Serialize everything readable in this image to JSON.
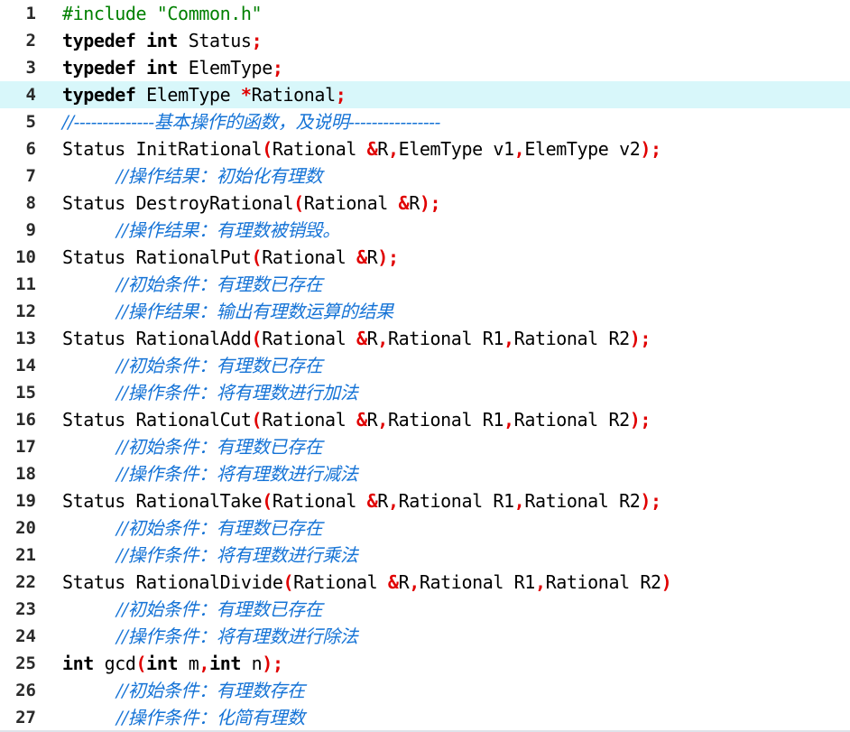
{
  "editor": {
    "current_line": 4,
    "lines": [
      {
        "num": "1",
        "indent": false,
        "tokens": [
          {
            "t": "pre",
            "v": "#include \"Common.h\""
          }
        ]
      },
      {
        "num": "2",
        "indent": false,
        "tokens": [
          {
            "t": "kw",
            "v": "typedef int"
          },
          {
            "t": "id",
            "v": " Status"
          },
          {
            "t": "op",
            "v": ";"
          }
        ]
      },
      {
        "num": "3",
        "indent": false,
        "tokens": [
          {
            "t": "kw",
            "v": "typedef int"
          },
          {
            "t": "id",
            "v": " ElemType"
          },
          {
            "t": "op",
            "v": ";"
          }
        ]
      },
      {
        "num": "4",
        "indent": false,
        "tokens": [
          {
            "t": "kw",
            "v": "typedef"
          },
          {
            "t": "id",
            "v": " ElemType "
          },
          {
            "t": "op",
            "v": "*"
          },
          {
            "t": "id",
            "v": "Rational"
          },
          {
            "t": "op",
            "v": ";"
          }
        ]
      },
      {
        "num": "5",
        "indent": false,
        "tokens": [
          {
            "t": "cm",
            "v": "//--------------基本操作的函数，及说明----------------"
          }
        ]
      },
      {
        "num": "6",
        "indent": false,
        "tokens": [
          {
            "t": "id",
            "v": "Status InitRational"
          },
          {
            "t": "op",
            "v": "("
          },
          {
            "t": "id",
            "v": "Rational "
          },
          {
            "t": "op",
            "v": "&"
          },
          {
            "t": "id",
            "v": "R"
          },
          {
            "t": "op",
            "v": ","
          },
          {
            "t": "id",
            "v": "ElemType v1"
          },
          {
            "t": "op",
            "v": ","
          },
          {
            "t": "id",
            "v": "ElemType v2"
          },
          {
            "t": "op",
            "v": ");"
          }
        ]
      },
      {
        "num": "7",
        "indent": true,
        "tokens": [
          {
            "t": "cm",
            "v": "//操作结果：初始化有理数"
          }
        ]
      },
      {
        "num": "8",
        "indent": false,
        "tokens": [
          {
            "t": "id",
            "v": "Status DestroyRational"
          },
          {
            "t": "op",
            "v": "("
          },
          {
            "t": "id",
            "v": "Rational "
          },
          {
            "t": "op",
            "v": "&"
          },
          {
            "t": "id",
            "v": "R"
          },
          {
            "t": "op",
            "v": ");"
          }
        ]
      },
      {
        "num": "9",
        "indent": true,
        "tokens": [
          {
            "t": "cm",
            "v": "//操作结果：有理数被销毁。"
          }
        ]
      },
      {
        "num": "10",
        "indent": false,
        "tokens": [
          {
            "t": "id",
            "v": "Status RationalPut"
          },
          {
            "t": "op",
            "v": "("
          },
          {
            "t": "id",
            "v": "Rational "
          },
          {
            "t": "op",
            "v": "&"
          },
          {
            "t": "id",
            "v": "R"
          },
          {
            "t": "op",
            "v": ");"
          }
        ]
      },
      {
        "num": "11",
        "indent": true,
        "tokens": [
          {
            "t": "cm",
            "v": "//初始条件：有理数已存在"
          }
        ]
      },
      {
        "num": "12",
        "indent": true,
        "tokens": [
          {
            "t": "cm",
            "v": "//操作结果：输出有理数运算的结果"
          }
        ]
      },
      {
        "num": "13",
        "indent": false,
        "tokens": [
          {
            "t": "id",
            "v": "Status RationalAdd"
          },
          {
            "t": "op",
            "v": "("
          },
          {
            "t": "id",
            "v": "Rational "
          },
          {
            "t": "op",
            "v": "&"
          },
          {
            "t": "id",
            "v": "R"
          },
          {
            "t": "op",
            "v": ","
          },
          {
            "t": "id",
            "v": "Rational R1"
          },
          {
            "t": "op",
            "v": ","
          },
          {
            "t": "id",
            "v": "Rational R2"
          },
          {
            "t": "op",
            "v": ");"
          }
        ]
      },
      {
        "num": "14",
        "indent": true,
        "tokens": [
          {
            "t": "cm",
            "v": "//初始条件：有理数已存在"
          }
        ]
      },
      {
        "num": "15",
        "indent": true,
        "tokens": [
          {
            "t": "cm",
            "v": "//操作条件：将有理数进行加法"
          }
        ]
      },
      {
        "num": "16",
        "indent": false,
        "tokens": [
          {
            "t": "id",
            "v": "Status RationalCut"
          },
          {
            "t": "op",
            "v": "("
          },
          {
            "t": "id",
            "v": "Rational "
          },
          {
            "t": "op",
            "v": "&"
          },
          {
            "t": "id",
            "v": "R"
          },
          {
            "t": "op",
            "v": ","
          },
          {
            "t": "id",
            "v": "Rational R1"
          },
          {
            "t": "op",
            "v": ","
          },
          {
            "t": "id",
            "v": "Rational R2"
          },
          {
            "t": "op",
            "v": ");"
          }
        ]
      },
      {
        "num": "17",
        "indent": true,
        "tokens": [
          {
            "t": "cm",
            "v": "//初始条件：有理数已存在"
          }
        ]
      },
      {
        "num": "18",
        "indent": true,
        "tokens": [
          {
            "t": "cm",
            "v": "//操作条件：将有理数进行减法"
          }
        ]
      },
      {
        "num": "19",
        "indent": false,
        "tokens": [
          {
            "t": "id",
            "v": "Status RationalTake"
          },
          {
            "t": "op",
            "v": "("
          },
          {
            "t": "id",
            "v": "Rational "
          },
          {
            "t": "op",
            "v": "&"
          },
          {
            "t": "id",
            "v": "R"
          },
          {
            "t": "op",
            "v": ","
          },
          {
            "t": "id",
            "v": "Rational R1"
          },
          {
            "t": "op",
            "v": ","
          },
          {
            "t": "id",
            "v": "Rational R2"
          },
          {
            "t": "op",
            "v": ");"
          }
        ]
      },
      {
        "num": "20",
        "indent": true,
        "tokens": [
          {
            "t": "cm",
            "v": "//初始条件：有理数已存在"
          }
        ]
      },
      {
        "num": "21",
        "indent": true,
        "tokens": [
          {
            "t": "cm",
            "v": "//操作条件：将有理数进行乘法"
          }
        ]
      },
      {
        "num": "22",
        "indent": false,
        "tokens": [
          {
            "t": "id",
            "v": "Status RationalDivide"
          },
          {
            "t": "op",
            "v": "("
          },
          {
            "t": "id",
            "v": "Rational "
          },
          {
            "t": "op",
            "v": "&"
          },
          {
            "t": "id",
            "v": "R"
          },
          {
            "t": "op",
            "v": ","
          },
          {
            "t": "id",
            "v": "Rational R1"
          },
          {
            "t": "op",
            "v": ","
          },
          {
            "t": "id",
            "v": "Rational R2"
          },
          {
            "t": "op",
            "v": ")"
          }
        ]
      },
      {
        "num": "23",
        "indent": true,
        "tokens": [
          {
            "t": "cm",
            "v": "//初始条件：有理数已存在"
          }
        ]
      },
      {
        "num": "24",
        "indent": true,
        "tokens": [
          {
            "t": "cm",
            "v": "//操作条件：将有理数进行除法"
          }
        ]
      },
      {
        "num": "25",
        "indent": false,
        "tokens": [
          {
            "t": "kw",
            "v": "int"
          },
          {
            "t": "id",
            "v": " gcd"
          },
          {
            "t": "op",
            "v": "("
          },
          {
            "t": "kw",
            "v": "int"
          },
          {
            "t": "id",
            "v": " m"
          },
          {
            "t": "op",
            "v": ","
          },
          {
            "t": "kw",
            "v": "int"
          },
          {
            "t": "id",
            "v": " n"
          },
          {
            "t": "op",
            "v": ");"
          }
        ]
      },
      {
        "num": "26",
        "indent": true,
        "tokens": [
          {
            "t": "cm",
            "v": "//初始条件：有理数存在"
          }
        ]
      },
      {
        "num": "27",
        "indent": true,
        "tokens": [
          {
            "t": "cm",
            "v": "//操作条件：化简有理数"
          }
        ]
      }
    ]
  },
  "colors": {
    "keyword": "#000000",
    "preprocessor": "#008000",
    "operator": "#e00000",
    "comment": "#1573d6",
    "current_line_bg": "#d8f7fa"
  }
}
